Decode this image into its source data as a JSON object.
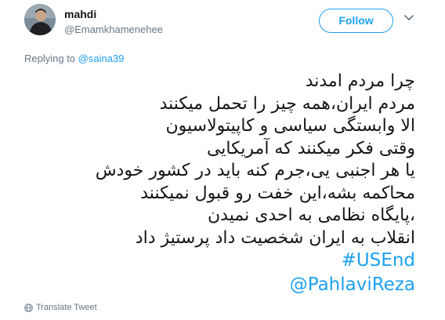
{
  "user": {
    "display_name": "mahdi",
    "handle": "@Emamkhamenehee"
  },
  "follow_button": {
    "label": "Follow"
  },
  "reply": {
    "prefix": "Replying to ",
    "mention": "@saina39"
  },
  "tweet": {
    "lines": [
      "چرا مردم امدند",
      "مردم ایران،همه چیز را تحمل میکنند",
      "الا وابستگی سیاسی و کاپیتولاسیون",
      "وقتی فکر میکنند که آمریکایی",
      " یا هر اجنبی یی،جرم کنه باید در کشور خودش",
      "محاکمه بشه،این خفت رو قبول نمیکنند",
      "،پایگاه نظامی به احدی نمیدن",
      "انقلاب به ایران شخصیت داد پرستیژ داد"
    ],
    "hashtag": "#USEnd",
    "mention": "@PahlaviReza"
  },
  "translate": {
    "label": "Translate Tweet"
  },
  "colors": {
    "accent": "#1da1f2",
    "secondary_text": "#657786",
    "primary_text": "#14171a"
  },
  "icons": {
    "avatar": "avatar",
    "menu": "chevron-down-icon",
    "translate": "globe-icon"
  }
}
